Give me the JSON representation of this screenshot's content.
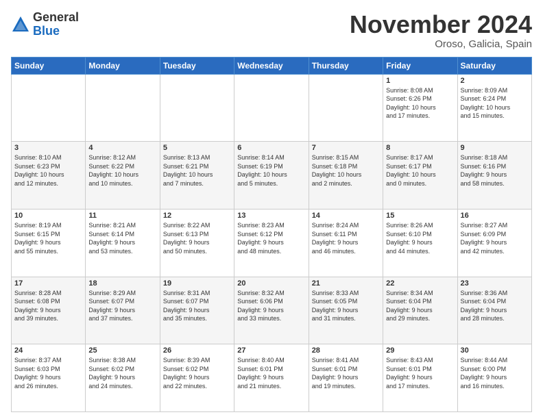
{
  "header": {
    "logo_general": "General",
    "logo_blue": "Blue",
    "month": "November 2024",
    "location": "Oroso, Galicia, Spain"
  },
  "weekdays": [
    "Sunday",
    "Monday",
    "Tuesday",
    "Wednesday",
    "Thursday",
    "Friday",
    "Saturday"
  ],
  "weeks": [
    [
      {
        "day": "",
        "info": ""
      },
      {
        "day": "",
        "info": ""
      },
      {
        "day": "",
        "info": ""
      },
      {
        "day": "",
        "info": ""
      },
      {
        "day": "",
        "info": ""
      },
      {
        "day": "1",
        "info": "Sunrise: 8:08 AM\nSunset: 6:26 PM\nDaylight: 10 hours\nand 17 minutes."
      },
      {
        "day": "2",
        "info": "Sunrise: 8:09 AM\nSunset: 6:24 PM\nDaylight: 10 hours\nand 15 minutes."
      }
    ],
    [
      {
        "day": "3",
        "info": "Sunrise: 8:10 AM\nSunset: 6:23 PM\nDaylight: 10 hours\nand 12 minutes."
      },
      {
        "day": "4",
        "info": "Sunrise: 8:12 AM\nSunset: 6:22 PM\nDaylight: 10 hours\nand 10 minutes."
      },
      {
        "day": "5",
        "info": "Sunrise: 8:13 AM\nSunset: 6:21 PM\nDaylight: 10 hours\nand 7 minutes."
      },
      {
        "day": "6",
        "info": "Sunrise: 8:14 AM\nSunset: 6:19 PM\nDaylight: 10 hours\nand 5 minutes."
      },
      {
        "day": "7",
        "info": "Sunrise: 8:15 AM\nSunset: 6:18 PM\nDaylight: 10 hours\nand 2 minutes."
      },
      {
        "day": "8",
        "info": "Sunrise: 8:17 AM\nSunset: 6:17 PM\nDaylight: 10 hours\nand 0 minutes."
      },
      {
        "day": "9",
        "info": "Sunrise: 8:18 AM\nSunset: 6:16 PM\nDaylight: 9 hours\nand 58 minutes."
      }
    ],
    [
      {
        "day": "10",
        "info": "Sunrise: 8:19 AM\nSunset: 6:15 PM\nDaylight: 9 hours\nand 55 minutes."
      },
      {
        "day": "11",
        "info": "Sunrise: 8:21 AM\nSunset: 6:14 PM\nDaylight: 9 hours\nand 53 minutes."
      },
      {
        "day": "12",
        "info": "Sunrise: 8:22 AM\nSunset: 6:13 PM\nDaylight: 9 hours\nand 50 minutes."
      },
      {
        "day": "13",
        "info": "Sunrise: 8:23 AM\nSunset: 6:12 PM\nDaylight: 9 hours\nand 48 minutes."
      },
      {
        "day": "14",
        "info": "Sunrise: 8:24 AM\nSunset: 6:11 PM\nDaylight: 9 hours\nand 46 minutes."
      },
      {
        "day": "15",
        "info": "Sunrise: 8:26 AM\nSunset: 6:10 PM\nDaylight: 9 hours\nand 44 minutes."
      },
      {
        "day": "16",
        "info": "Sunrise: 8:27 AM\nSunset: 6:09 PM\nDaylight: 9 hours\nand 42 minutes."
      }
    ],
    [
      {
        "day": "17",
        "info": "Sunrise: 8:28 AM\nSunset: 6:08 PM\nDaylight: 9 hours\nand 39 minutes."
      },
      {
        "day": "18",
        "info": "Sunrise: 8:29 AM\nSunset: 6:07 PM\nDaylight: 9 hours\nand 37 minutes."
      },
      {
        "day": "19",
        "info": "Sunrise: 8:31 AM\nSunset: 6:07 PM\nDaylight: 9 hours\nand 35 minutes."
      },
      {
        "day": "20",
        "info": "Sunrise: 8:32 AM\nSunset: 6:06 PM\nDaylight: 9 hours\nand 33 minutes."
      },
      {
        "day": "21",
        "info": "Sunrise: 8:33 AM\nSunset: 6:05 PM\nDaylight: 9 hours\nand 31 minutes."
      },
      {
        "day": "22",
        "info": "Sunrise: 8:34 AM\nSunset: 6:04 PM\nDaylight: 9 hours\nand 29 minutes."
      },
      {
        "day": "23",
        "info": "Sunrise: 8:36 AM\nSunset: 6:04 PM\nDaylight: 9 hours\nand 28 minutes."
      }
    ],
    [
      {
        "day": "24",
        "info": "Sunrise: 8:37 AM\nSunset: 6:03 PM\nDaylight: 9 hours\nand 26 minutes."
      },
      {
        "day": "25",
        "info": "Sunrise: 8:38 AM\nSunset: 6:02 PM\nDaylight: 9 hours\nand 24 minutes."
      },
      {
        "day": "26",
        "info": "Sunrise: 8:39 AM\nSunset: 6:02 PM\nDaylight: 9 hours\nand 22 minutes."
      },
      {
        "day": "27",
        "info": "Sunrise: 8:40 AM\nSunset: 6:01 PM\nDaylight: 9 hours\nand 21 minutes."
      },
      {
        "day": "28",
        "info": "Sunrise: 8:41 AM\nSunset: 6:01 PM\nDaylight: 9 hours\nand 19 minutes."
      },
      {
        "day": "29",
        "info": "Sunrise: 8:43 AM\nSunset: 6:01 PM\nDaylight: 9 hours\nand 17 minutes."
      },
      {
        "day": "30",
        "info": "Sunrise: 8:44 AM\nSunset: 6:00 PM\nDaylight: 9 hours\nand 16 minutes."
      }
    ]
  ]
}
